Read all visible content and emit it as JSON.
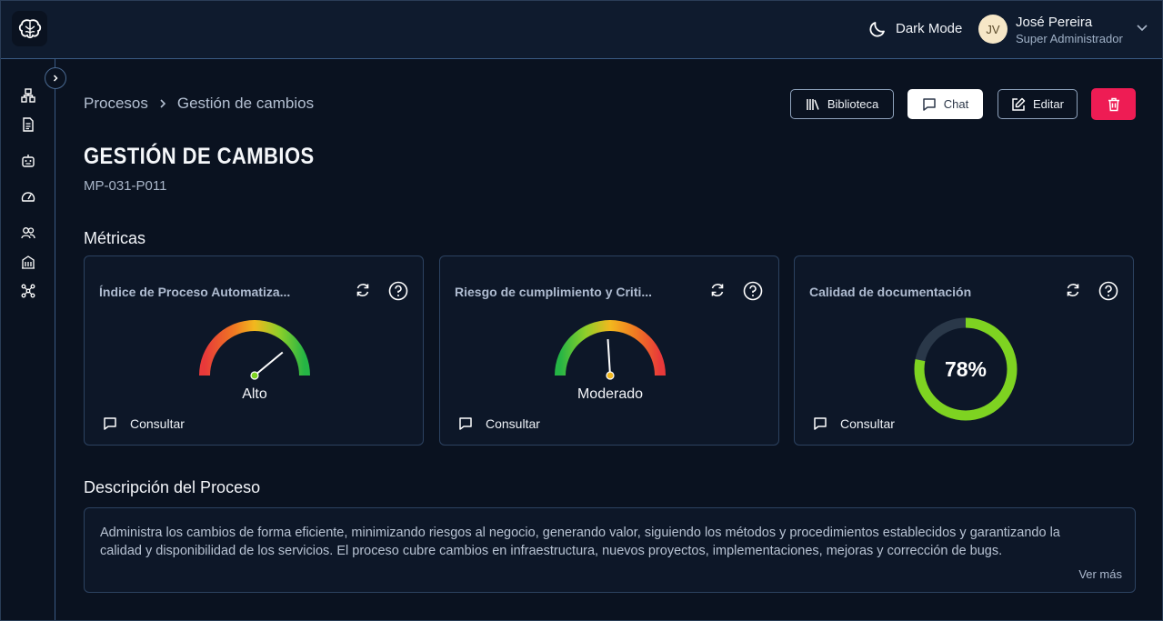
{
  "header": {
    "dark_mode_label": "Dark Mode",
    "user": {
      "initials": "JV",
      "name": "José Pereira",
      "role": "Super Administrador"
    }
  },
  "sidebar": {
    "items": [
      "processes-icon",
      "document-icon",
      "bot-icon",
      "dashboard-icon",
      "users-icon",
      "building-icon",
      "integrations-icon"
    ]
  },
  "breadcrumb": {
    "items": [
      "Procesos",
      "Gestión de cambios"
    ]
  },
  "actions": {
    "library": "Biblioteca",
    "chat": "Chat",
    "edit": "Editar"
  },
  "page": {
    "title": "GESTIÓN DE CAMBIOS",
    "code": "MP-031-P011"
  },
  "metrics": {
    "section_title": "Métricas",
    "cards": [
      {
        "title": "Índice de Proceso Automatiza...",
        "type": "gauge",
        "label": "Alto",
        "level": 0.78,
        "consult_label": "Consultar"
      },
      {
        "title": "Riesgo de cumplimiento y Criti...",
        "type": "gauge",
        "label": "Moderado",
        "level": 0.48,
        "consult_label": "Consultar"
      },
      {
        "title": "Calidad de documentación",
        "type": "donut",
        "value": "78%",
        "percent": 78,
        "consult_label": "Consultar"
      }
    ]
  },
  "description": {
    "section_title": "Descripción del Proceso",
    "text": "Administra los cambios de forma eficiente, minimizando riesgos al negocio, generando valor, siguiendo los métodos y procedimientos establecidos y garantizando la calidad y disponibilidad de los servicios. El proceso cubre cambios en infraestructura, nuevos proyectos, implementaciones, mejoras y corrección de bugs.",
    "more_label": "Ver más"
  },
  "colors": {
    "accent_green": "#7ed321",
    "delete_red": "#ee1c54",
    "gauge_red": "#e8393a",
    "gauge_yellow": "#f2b81e"
  }
}
